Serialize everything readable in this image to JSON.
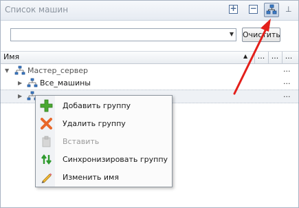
{
  "window": {
    "title": "Список машин"
  },
  "toolbar": {
    "expand_icon": "expand-all-icon",
    "collapse_icon": "collapse-all-icon",
    "groups_icon": "network-groups-icon",
    "pin_icon": "pin-icon"
  },
  "search": {
    "value": "",
    "placeholder": "",
    "clear_label": "Очистить"
  },
  "grid": {
    "column_name": "Имя",
    "extra_columns": [
      "...",
      "...",
      "..."
    ]
  },
  "tree": [
    {
      "label": "Мастер_сервер",
      "dots": "...",
      "expander": "▼"
    },
    {
      "label": "Все_машины",
      "dots": "...",
      "expander": "▶"
    },
    {
      "label": "",
      "dots": "...",
      "expander": "▶"
    }
  ],
  "context_menu": {
    "items": [
      {
        "label": "Добавить группу",
        "icon": "add-icon",
        "enabled": true
      },
      {
        "label": "Удалить группу",
        "icon": "delete-icon",
        "enabled": true
      },
      {
        "label": "Вставить",
        "icon": "paste-icon",
        "enabled": false
      },
      {
        "label": "Синхронизировать группу",
        "icon": "sync-icon",
        "enabled": true
      },
      {
        "label": "Изменить имя",
        "icon": "rename-icon",
        "enabled": true
      }
    ]
  },
  "colors": {
    "accent_arrow": "#e3201b",
    "add_green": "#4aa832",
    "delete_orange": "#e8682a"
  }
}
